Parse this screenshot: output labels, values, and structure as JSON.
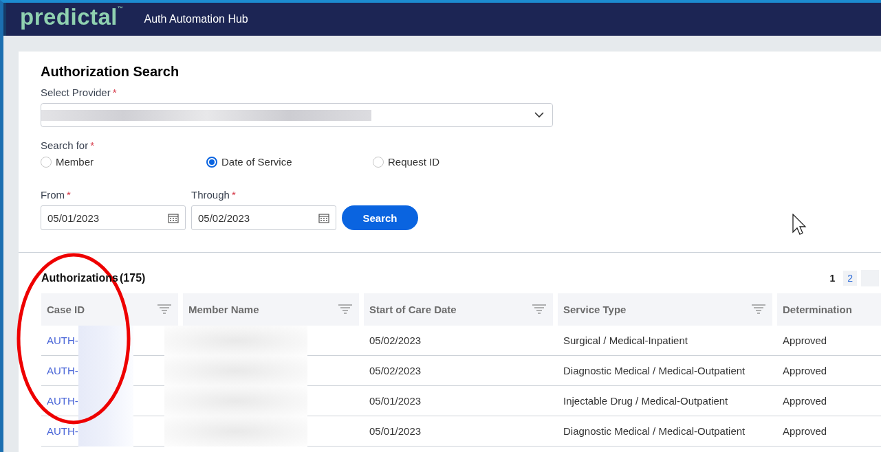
{
  "header": {
    "logo": "predictal",
    "trademark": "™",
    "app_title": "Auth Automation Hub"
  },
  "search_form": {
    "title": "Authorization Search",
    "provider": {
      "label": "Select Provider",
      "required_mark": "*",
      "value_redacted": true
    },
    "search_for": {
      "label": "Search for",
      "required_mark": "*",
      "options": [
        {
          "label": "Member",
          "selected": false
        },
        {
          "label": "Date of Service",
          "selected": true
        },
        {
          "label": "Request ID",
          "selected": false
        }
      ]
    },
    "from": {
      "label": "From",
      "required_mark": "*",
      "value": "05/01/2023"
    },
    "through": {
      "label": "Through",
      "required_mark": "*",
      "value": "05/02/2023"
    },
    "search_button": "Search"
  },
  "results": {
    "title": "Authorizations",
    "count": "(175)",
    "pages": [
      {
        "label": "1",
        "selected": true
      },
      {
        "label": "2",
        "selected": false
      }
    ],
    "columns": [
      {
        "label": "Case ID",
        "filter": true
      },
      {
        "label": "Member Name",
        "filter": true
      },
      {
        "label": "Start of Care Date",
        "filter": true
      },
      {
        "label": "Service Type",
        "filter": true
      },
      {
        "label": "Determination"
      }
    ],
    "rows": [
      {
        "case_id": "AUTH-",
        "start": "05/02/2023",
        "service_type": "Surgical / Medical-Inpatient",
        "determination": "Approved"
      },
      {
        "case_id": "AUTH-",
        "start": "05/02/2023",
        "service_type": "Diagnostic Medical / Medical-Outpatient",
        "determination": "Approved"
      },
      {
        "case_id": "AUTH-",
        "start": "05/01/2023",
        "service_type": "Injectable Drug / Medical-Outpatient",
        "determination": "Approved"
      },
      {
        "case_id": "AUTH-",
        "start": "05/01/2023",
        "service_type": "Diagnostic Medical / Medical-Outpatient",
        "determination": "Approved"
      }
    ]
  }
}
